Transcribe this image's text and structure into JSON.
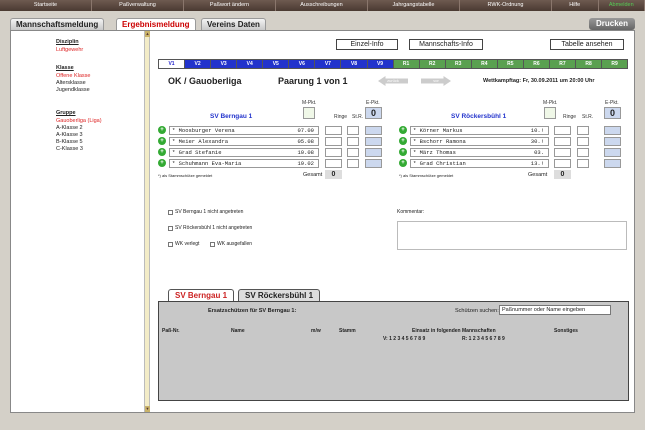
{
  "topnav": [
    "Startseite",
    "Paßverwaltung",
    "Paßwort ändern",
    "Ausschreibungen",
    "Jahrgangstabelle",
    "RWK-Ordnung",
    "Hilfe",
    "Abmelden"
  ],
  "tabs": [
    "Mannschaftsmeldung",
    "Ergebnismeldung",
    "Vereins Daten"
  ],
  "drucken": "Drucken",
  "sidebar": {
    "disziplin_label": "Disziplin",
    "disziplin_items": [
      "Luftgewehr"
    ],
    "klasse_label": "Klasse",
    "klasse_items": [
      "Offene Klasse",
      "Altersklasse",
      "Jugendklasse"
    ],
    "gruppe_label": "Gruppe",
    "gruppe_items": [
      "Gauoberliga (Liga)",
      "A-Klasse 2",
      "A-Klasse 3",
      "B-Klasse 5",
      "C-Klasse 3"
    ]
  },
  "buttons": {
    "einzel": "Einzel-Info",
    "mannschaft": "Mannschafts-Info",
    "tabelle": "Tabelle ansehen"
  },
  "vtabs": {
    "blue": [
      "V1",
      "V2",
      "V3",
      "V4",
      "V5",
      "V6",
      "V7",
      "V8",
      "V9"
    ],
    "green": [
      "R1",
      "R2",
      "R3",
      "R4",
      "R5",
      "R6",
      "R7",
      "R8",
      "R9"
    ]
  },
  "match": {
    "liga": "OK / Gauoberliga",
    "paarung": "Paarung 1 von 1",
    "prev": "zurück",
    "next": "vor",
    "wettkampftag": "Wettkampftag: Fr, 30.09.2011 um 20:00 Uhr"
  },
  "labels": {
    "mpkt": "M-Pkt.",
    "epkt": "E-Pkt.",
    "ringe": "Ringe",
    "str": "St.R.",
    "gesamt": "Gesamt",
    "note": "*) als Stammschütze gemeldet"
  },
  "home": {
    "name": "SV Berngau 1",
    "epkt": "0",
    "gesamt": "0",
    "players": [
      {
        "name": "* Moosburger Verena",
        "num": "07.09"
      },
      {
        "name": "* Meier Alexandra",
        "num": "05.08"
      },
      {
        "name": "* Grad Stefanie",
        "num": "10.08"
      },
      {
        "name": "* Schuhmann Eva-Maria",
        "num": "19.02"
      }
    ]
  },
  "guest": {
    "name": "SV Röckersbühl 1",
    "epkt": "0",
    "gesamt": "0",
    "players": [
      {
        "name": "* Körner Markus",
        "num": "10.!"
      },
      {
        "name": "* Bschorr Ramona",
        "num": "30.!"
      },
      {
        "name": "* März Thomas",
        "num": "03."
      },
      {
        "name": "* Grad Christian",
        "num": "13.!"
      }
    ]
  },
  "checks": {
    "home_na": "SV Berngau 1 nicht angetreten",
    "guest_na": "SV Röckersbühl 1 nicht angetreten",
    "verlegt": "WK verlegt",
    "ausgefallen": "WK ausgefallen"
  },
  "kommentar": "Kommentar:",
  "bottom": {
    "tabs": [
      "SV Berngau 1",
      "SV Röckersbühl 1"
    ],
    "ersatz": "Ersatzschützen für SV Berngau 1:",
    "search_label": "Schützen suchen:",
    "search_placeholder": "Paßnummer oder Name eingeben",
    "cols": [
      "Paß-Nr.",
      "Name",
      "m/w",
      "Stamm",
      "Einsatz in folgenden Mannschaften",
      "Sonstiges"
    ],
    "v_label": "V: 1 2 3 4 5 6 7 8 9",
    "r_label": "R: 1 2 3 4 5 6 7 8 9"
  },
  "colors": {
    "accent_red": "#dd2222",
    "accent_blue": "#2233cc",
    "accent_green": "#5aa050"
  }
}
